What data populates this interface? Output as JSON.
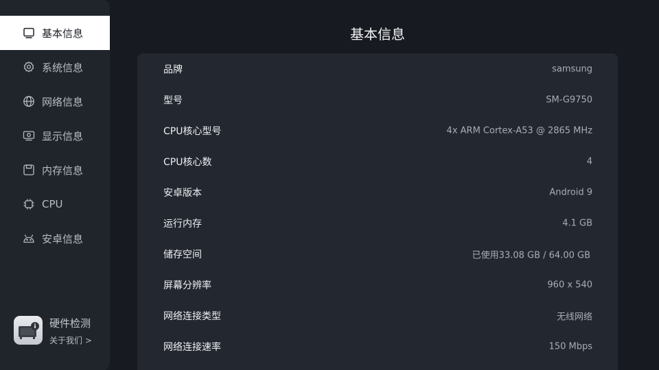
{
  "page": {
    "title": "基本信息"
  },
  "sidebar": {
    "items": [
      {
        "label": "基本信息",
        "icon": "tablet-icon",
        "active": true
      },
      {
        "label": "系统信息",
        "icon": "gear-icon",
        "active": false
      },
      {
        "label": "网络信息",
        "icon": "globe-icon",
        "active": false
      },
      {
        "label": "显示信息",
        "icon": "display-icon",
        "active": false
      },
      {
        "label": "内存信息",
        "icon": "memory-icon",
        "active": false
      },
      {
        "label": "CPU",
        "icon": "chip-icon",
        "active": false
      },
      {
        "label": "安卓信息",
        "icon": "android-icon",
        "active": false
      }
    ],
    "app": {
      "name": "硬件检测",
      "about": "关于我们 >",
      "logo_icon": "hardware-info-logo-icon"
    }
  },
  "info": {
    "rows": [
      {
        "label": "品牌",
        "value": "samsung"
      },
      {
        "label": "型号",
        "value": "SM-G9750"
      },
      {
        "label": "CPU核心型号",
        "value": "4x ARM Cortex-A53 @ 2865 MHz"
      },
      {
        "label": "CPU核心数",
        "value": "4"
      },
      {
        "label": "安卓版本",
        "value": "Android 9"
      },
      {
        "label": "运行内存",
        "value": "4.1 GB"
      },
      {
        "label": "储存空间",
        "value": "已使用33.08 GB / 64.00 GB"
      },
      {
        "label": "屏幕分辨率",
        "value": "960 x 540"
      },
      {
        "label": "网络连接类型",
        "value": "无线网络"
      },
      {
        "label": "网络连接速率",
        "value": "150 Mbps"
      }
    ]
  },
  "colors": {
    "background": "#171a20",
    "sidebar": "#20242b",
    "panel": "#23272f",
    "active_item_bg": "#ffffff",
    "label_text": "#eef0f3",
    "value_text": "#a9adb5"
  }
}
